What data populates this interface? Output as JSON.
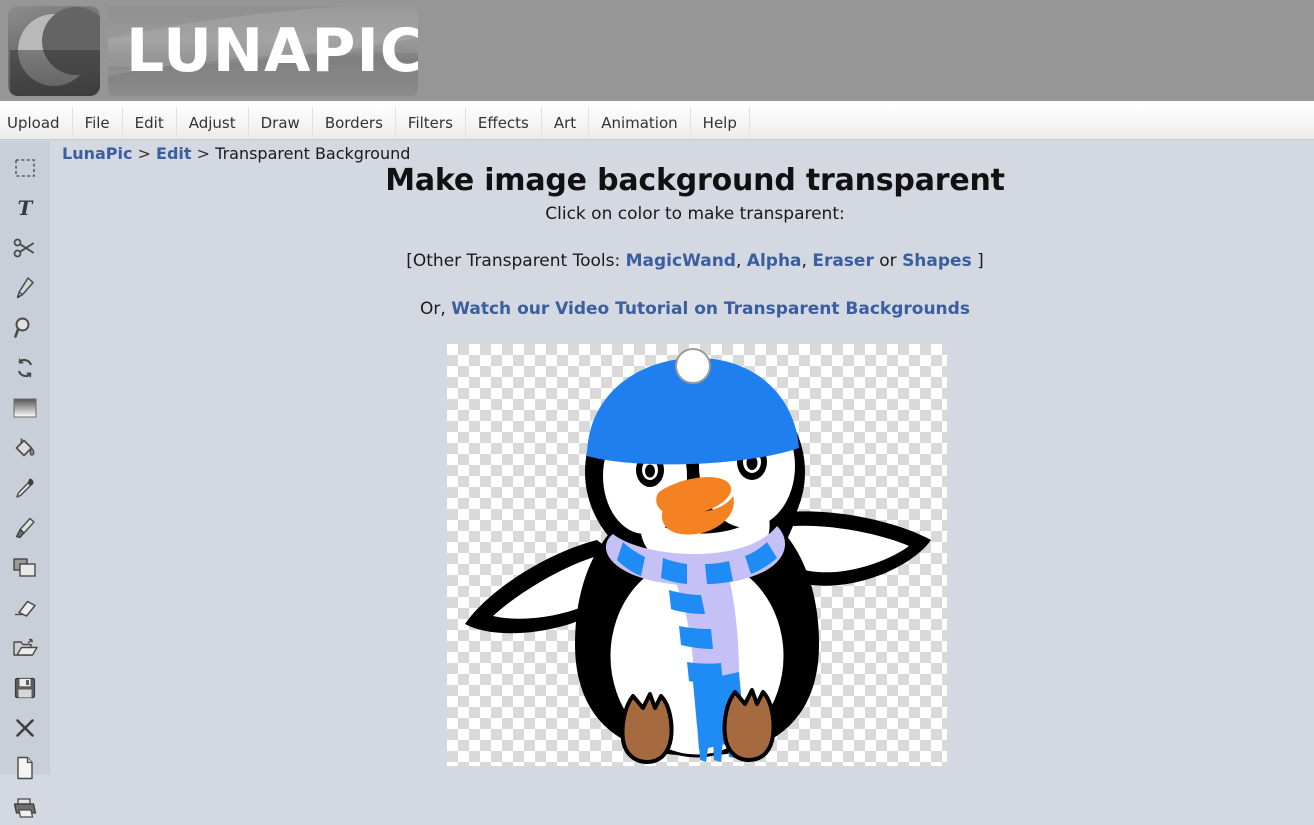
{
  "header": {
    "logo_text": "LUNAPIC",
    "logo_icon": "crescent-moon-icon"
  },
  "menu": {
    "items": [
      {
        "label": "Upload"
      },
      {
        "label": "File"
      },
      {
        "label": "Edit"
      },
      {
        "label": "Adjust"
      },
      {
        "label": "Draw"
      },
      {
        "label": "Borders"
      },
      {
        "label": "Filters"
      },
      {
        "label": "Effects"
      },
      {
        "label": "Art"
      },
      {
        "label": "Animation"
      },
      {
        "label": "Help"
      }
    ]
  },
  "sidebar": {
    "tools": [
      {
        "name": "marquee-select-icon",
        "title": "Select"
      },
      {
        "name": "text-icon",
        "title": "Text"
      },
      {
        "name": "scissors-icon",
        "title": "Cut"
      },
      {
        "name": "pencil-icon",
        "title": "Pencil"
      },
      {
        "name": "magnifier-icon",
        "title": "Zoom"
      },
      {
        "name": "rotate-icon",
        "title": "Rotate"
      },
      {
        "name": "gradient-icon",
        "title": "Gradient"
      },
      {
        "name": "paint-bucket-icon",
        "title": "Fill"
      },
      {
        "name": "eyedropper-icon",
        "title": "Color Picker"
      },
      {
        "name": "paintbrush-icon",
        "title": "Brush"
      },
      {
        "name": "copy-layers-icon",
        "title": "Copy"
      },
      {
        "name": "eraser-icon",
        "title": "Eraser"
      },
      {
        "name": "open-folder-icon",
        "title": "Open"
      },
      {
        "name": "save-floppy-icon",
        "title": "Save"
      },
      {
        "name": "close-x-icon",
        "title": "Close"
      },
      {
        "name": "new-document-icon",
        "title": "New"
      },
      {
        "name": "printer-icon",
        "title": "Print"
      }
    ]
  },
  "breadcrumb": {
    "root": "LunaPic",
    "sep1": " > ",
    "section": "Edit",
    "sep2": " > ",
    "current": "Transparent Background"
  },
  "main": {
    "title": "Make image background transparent",
    "subtitle": "Click on color to make transparent:",
    "tools_line": {
      "prefix": "[Other Transparent Tools: ",
      "link1": "MagicWand",
      "comma1": ", ",
      "link2": "Alpha",
      "comma2": ", ",
      "link3": "Eraser",
      "or": " or ",
      "link4": "Shapes",
      "suffix": " ]"
    },
    "video_line": {
      "prefix": "Or, ",
      "link": "Watch our Video Tutorial on Transparent Backgrounds"
    }
  },
  "image": {
    "alt": "cartoon penguin with blue beanie hat and striped scarf",
    "background": "transparency-checkerboard",
    "colors": {
      "hat_blue": "#1f7fee",
      "scarf_blue": "#1f8cf5",
      "scarf_lavender": "#c5c0f5",
      "beak_orange": "#f58220",
      "feet_brown": "#a56a3f",
      "body_black": "#000000",
      "belly_white": "#ffffff",
      "checker_gray": "#d9d9d9"
    }
  },
  "theme": {
    "page_background": "#d3d8e1",
    "sidebar_background": "#c9cfd9",
    "header_gray": "#969696",
    "link_blue": "#3b5ea0",
    "menubar_background": "#f5f5f5"
  }
}
